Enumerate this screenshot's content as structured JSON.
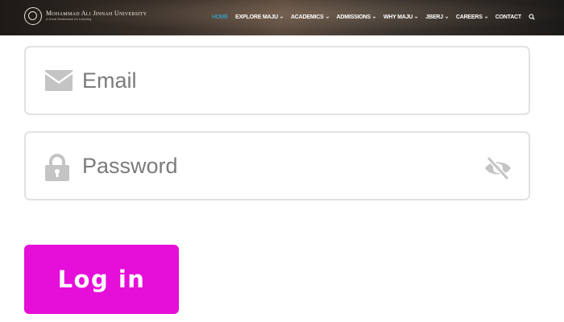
{
  "header": {
    "logo_name": "Mohammad Ali Jinnah University",
    "logo_tagline": "A Great Destination for Learning",
    "nav": [
      {
        "label": "HOME",
        "active": true,
        "has_dropdown": false
      },
      {
        "label": "EXPLORE MAJU",
        "active": false,
        "has_dropdown": true
      },
      {
        "label": "ACADEMICS",
        "active": false,
        "has_dropdown": true
      },
      {
        "label": "ADMISSIONS",
        "active": false,
        "has_dropdown": true
      },
      {
        "label": "WHY MAJU",
        "active": false,
        "has_dropdown": true
      },
      {
        "label": "JBERJ",
        "active": false,
        "has_dropdown": true
      },
      {
        "label": "CAREERS",
        "active": false,
        "has_dropdown": true
      },
      {
        "label": "CONTACT",
        "active": false,
        "has_dropdown": false
      }
    ],
    "search_icon": "search-icon",
    "active_color": "#28b6e8"
  },
  "form": {
    "email": {
      "placeholder": "Email",
      "value": "",
      "icon": "envelope-icon"
    },
    "password": {
      "placeholder": "Password",
      "value": "",
      "icon": "lock-icon",
      "toggle_icon": "eye-slash-icon"
    },
    "submit_label": "Log in",
    "submit_color": "#e60ed9"
  }
}
